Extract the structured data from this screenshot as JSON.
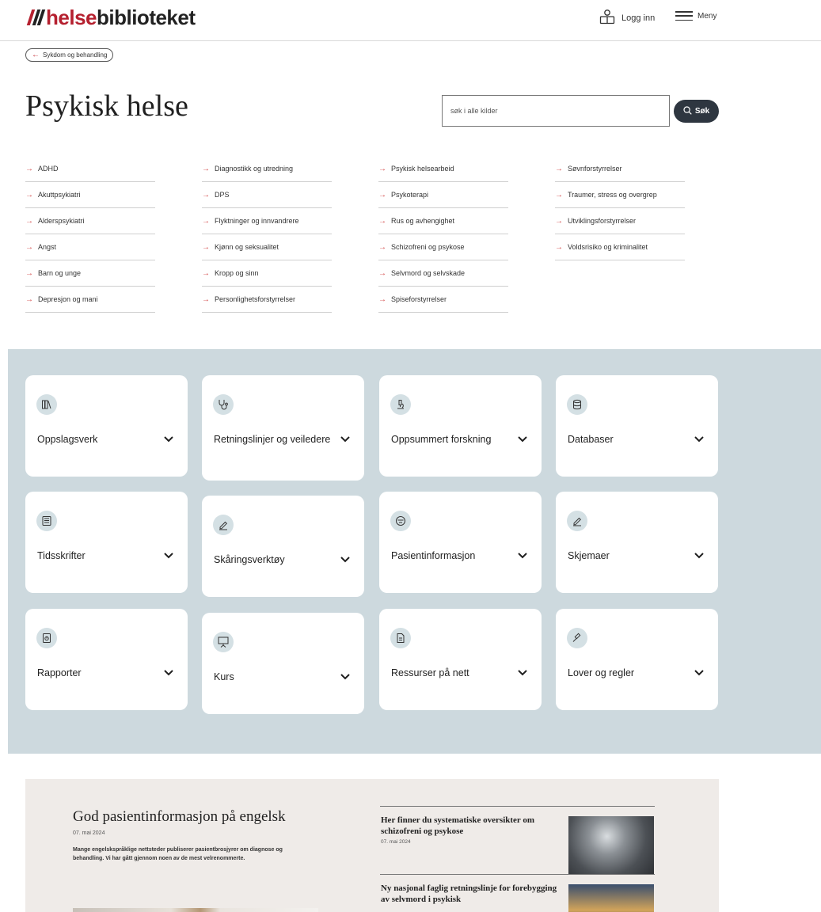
{
  "header": {
    "logo_red": "helse",
    "logo_dark": "biblioteket",
    "login_label": "Logg inn",
    "menu_label": "Meny"
  },
  "breadcrumb": {
    "label": "Sykdom og behandling"
  },
  "page": {
    "title": "Psykisk helse"
  },
  "search": {
    "placeholder": "søk i alle kilder",
    "button_label": "Søk"
  },
  "topics": [
    [
      "ADHD",
      "Akuttpsykiatri",
      "Alderspsykiatri",
      "Angst",
      "Barn og unge",
      "Depresjon og mani"
    ],
    [
      "Diagnostikk og utredning",
      "DPS",
      "Flyktninger og innvandrere",
      "Kjønn og seksualitet",
      "Kropp og sinn",
      "Personlighetsforstyrrelser"
    ],
    [
      "Psykisk helsearbeid",
      "Psykoterapi",
      "Rus og avhengighet",
      "Schizofreni og psykose",
      "Selvmord og selvskade",
      "Spiseforstyrrelser"
    ],
    [
      "Søvnforstyrrelser",
      "Traumer, stress og overgrep",
      "Utviklingsforstyrrelser",
      "Voldsrisiko og kriminalitet"
    ]
  ],
  "categories": [
    {
      "label": "Oppslagsverk",
      "icon": "books-icon"
    },
    {
      "label": "Retningslinjer og veiledere",
      "icon": "stethoscope-icon"
    },
    {
      "label": "Oppsummert forskning",
      "icon": "microscope-icon"
    },
    {
      "label": "Databaser",
      "icon": "database-icon"
    },
    {
      "label": "Tidsskrifter",
      "icon": "journal-icon"
    },
    {
      "label": "Skåringsverktøy",
      "icon": "pen-icon"
    },
    {
      "label": "Pasientinformasjon",
      "icon": "patient-icon"
    },
    {
      "label": "Skjemaer",
      "icon": "pen-icon"
    },
    {
      "label": "Rapporter",
      "icon": "report-icon"
    },
    {
      "label": "Kurs",
      "icon": "presentation-icon"
    },
    {
      "label": "Ressurser på nett",
      "icon": "document-icon"
    },
    {
      "label": "Lover og regler",
      "icon": "gavel-icon"
    }
  ],
  "news": {
    "main": {
      "title": "God pasientinformasjon på engelsk",
      "date": "07. mai 2024",
      "text": "Mange engelskspråklige nettsteder publiserer pasientbrosjyrer om diagnose og behandling. Vi har gått gjennom noen av de mest velrenommerte."
    },
    "side": [
      {
        "title": "Her finner du systematiske oversikter om schizofreni og psykose",
        "date": "07. mai 2024"
      },
      {
        "title": "Ny nasjonal faglig retningslinje for forebygging av selvmord i psykisk",
        "date": ""
      }
    ]
  }
}
